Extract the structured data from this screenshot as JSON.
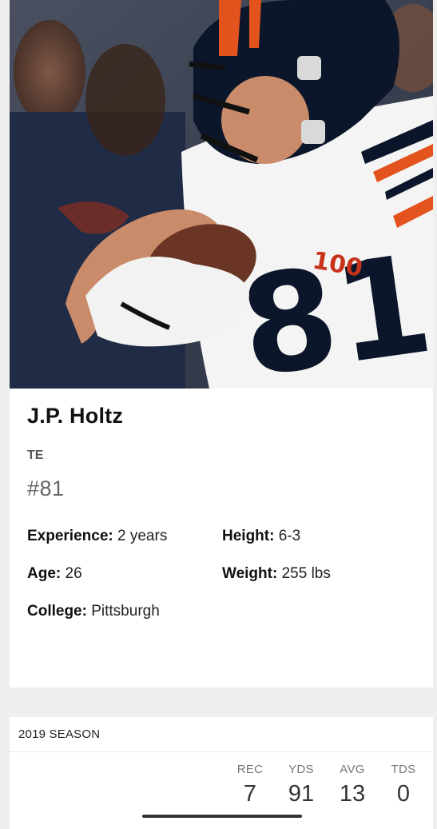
{
  "player": {
    "name": "J.P. Holtz",
    "position": "TE",
    "number": "#81",
    "experience_label": "Experience:",
    "experience_value": "2 years",
    "height_label": "Height:",
    "height_value": "6-3",
    "age_label": "Age:",
    "age_value": "26",
    "weight_label": "Weight:",
    "weight_value": "255 lbs",
    "college_label": "College:",
    "college_value": "Pittsburgh"
  },
  "season": {
    "title": "2019 SEASON",
    "stats": [
      {
        "label": "REC",
        "value": "7"
      },
      {
        "label": "YDS",
        "value": "91"
      },
      {
        "label": "AVG",
        "value": "13"
      },
      {
        "label": "TDS",
        "value": "0"
      }
    ]
  },
  "colors": {
    "navy": "#0b162a",
    "orange": "#e2531d",
    "background": "#efefef"
  }
}
